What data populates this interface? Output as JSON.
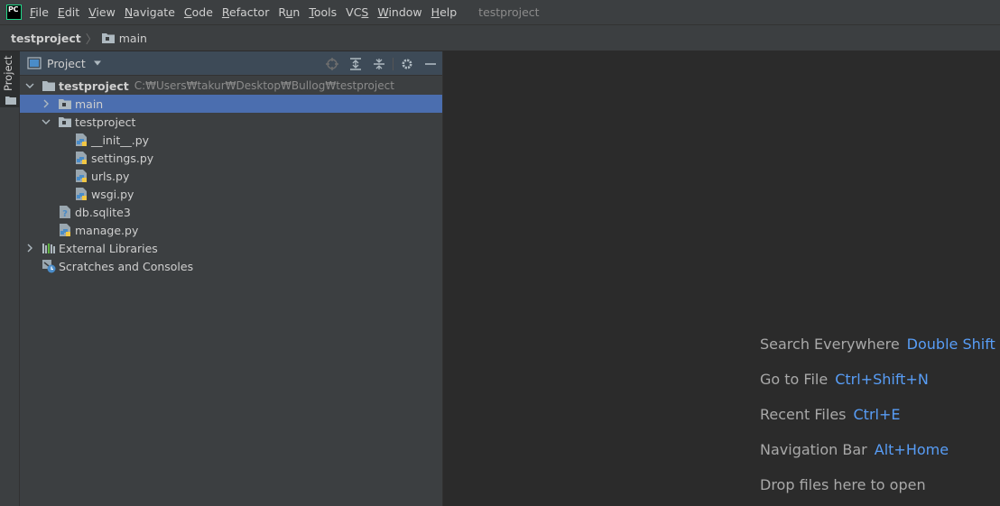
{
  "app": {
    "logo_text": "PC",
    "accent": "#21d789"
  },
  "menu": [
    {
      "pre": "",
      "u": "F",
      "post": "ile"
    },
    {
      "pre": "",
      "u": "E",
      "post": "dit"
    },
    {
      "pre": "",
      "u": "V",
      "post": "iew"
    },
    {
      "pre": "",
      "u": "N",
      "post": "avigate"
    },
    {
      "pre": "",
      "u": "C",
      "post": "ode"
    },
    {
      "pre": "",
      "u": "R",
      "post": "efactor"
    },
    {
      "pre": "R",
      "u": "u",
      "post": "n"
    },
    {
      "pre": "",
      "u": "T",
      "post": "ools"
    },
    {
      "pre": "VC",
      "u": "S",
      "post": ""
    },
    {
      "pre": "",
      "u": "W",
      "post": "indow"
    },
    {
      "pre": "",
      "u": "H",
      "post": "elp"
    }
  ],
  "window_title": "testproject",
  "breadcrumb": {
    "root": "testproject",
    "separator": "〉",
    "child": "main"
  },
  "tool_stripe": {
    "tab_label": "Project"
  },
  "project_panel": {
    "title": "Project",
    "header_icons": [
      "locate-icon",
      "expand-all-icon",
      "collapse-all-icon",
      "gear-icon",
      "minimize-icon"
    ]
  },
  "tree": [
    {
      "label": "testproject",
      "path": "C:₩Users₩takur₩Desktop₩Bullog₩testproject",
      "icon": "folder-icon",
      "arrow": "down",
      "indent": 0,
      "bold": true
    },
    {
      "label": "main",
      "path": "",
      "icon": "package-folder-icon",
      "arrow": "right",
      "indent": 1,
      "selected": true
    },
    {
      "label": "testproject",
      "path": "",
      "icon": "package-folder-icon",
      "arrow": "down",
      "indent": 1
    },
    {
      "label": "__init__.py",
      "path": "",
      "icon": "python-file-icon",
      "arrow": "",
      "indent": 2
    },
    {
      "label": "settings.py",
      "path": "",
      "icon": "python-file-icon",
      "arrow": "",
      "indent": 2
    },
    {
      "label": "urls.py",
      "path": "",
      "icon": "python-file-icon",
      "arrow": "",
      "indent": 2
    },
    {
      "label": "wsgi.py",
      "path": "",
      "icon": "python-file-icon",
      "arrow": "",
      "indent": 2
    },
    {
      "label": "db.sqlite3",
      "path": "",
      "icon": "unknown-file-icon",
      "arrow": "",
      "indent": 1
    },
    {
      "label": "manage.py",
      "path": "",
      "icon": "python-file-icon",
      "arrow": "",
      "indent": 1
    },
    {
      "label": "External Libraries",
      "path": "",
      "icon": "libraries-icon",
      "arrow": "right",
      "indent": 0
    },
    {
      "label": "Scratches and Consoles",
      "path": "",
      "icon": "scratches-icon",
      "arrow": "",
      "indent": 0
    }
  ],
  "editor_hints": [
    {
      "text": "Search Everywhere",
      "shortcut": "Double Shift"
    },
    {
      "text": "Go to File",
      "shortcut": "Ctrl+Shift+N"
    },
    {
      "text": "Recent Files",
      "shortcut": "Ctrl+E"
    },
    {
      "text": "Navigation Bar",
      "shortcut": "Alt+Home"
    },
    {
      "text": "Drop files here to open",
      "shortcut": ""
    }
  ],
  "colors": {
    "selection": "#4b6eaf",
    "shortcut": "#589df6",
    "folder": "#aeb9c0",
    "python_blue": "#4a8cc8",
    "python_yellow": "#f2c744"
  }
}
